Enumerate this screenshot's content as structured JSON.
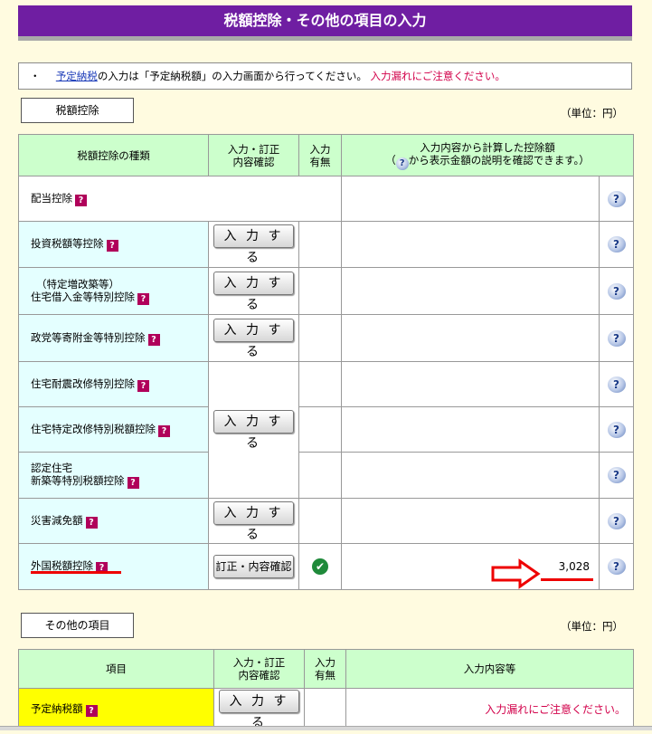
{
  "page": {
    "title": "税額控除・その他の項目の入力"
  },
  "notice": {
    "bullet": "・",
    "link_text": "予定納税",
    "text": "の入力は「予定納税額」の入力画面から行ってください。",
    "warning": "入力漏れにご注意ください。"
  },
  "tax_credit": {
    "section_label": "税額控除",
    "unit": "（単位：円）",
    "headers": {
      "type": "税額控除の種類",
      "confirm": "入力・訂正\n内容確認",
      "has_input": "入力\n有無",
      "amount_line1": "入力内容から計算した控除額",
      "amount_line2_pre": "（",
      "amount_line2_post": "から表示金額の説明を確認できます。）"
    },
    "rows": [
      {
        "label": "配当控除"
      },
      {
        "label": "投資税額等控除",
        "button": "入 力 す る"
      },
      {
        "label_line1": "（特定増改築等）",
        "label_line2": "住宅借入金等特別控除",
        "button": "入 力 す る"
      },
      {
        "label": "政党等寄附金等特別控除",
        "button": "入 力 す る"
      },
      {
        "label": "住宅耐震改修特別控除"
      },
      {
        "label": "住宅特定改修特別税額控除",
        "button": "入 力 す る"
      },
      {
        "label_line1": "認定住宅",
        "label_line2": "新築等特別税額控除"
      },
      {
        "label": "災害減免額",
        "button": "入 力 す る"
      },
      {
        "label": "外国税額控除",
        "button": "訂正・内容確認",
        "amount": "3,028"
      }
    ]
  },
  "other": {
    "section_label": "その他の項目",
    "unit": "（単位：円）",
    "headers": {
      "item": "項目",
      "confirm": "入力・訂正\n内容確認",
      "has_input": "入力\n有無",
      "content": "入力内容等"
    },
    "rows": [
      {
        "label": "予定納税額",
        "button": "入 力 す る",
        "warning": "入力漏れにご注意ください。"
      }
    ]
  },
  "icons": {
    "question_mark": "?",
    "check": "✔"
  },
  "colors": {
    "header_purple": "#6f1ea2",
    "table_header_green": "#ccffcc",
    "label_cyan": "#e4ffff",
    "highlight_yellow": "#ffff00",
    "warning_red": "#d2004a",
    "annotation_red": "#e00000"
  }
}
